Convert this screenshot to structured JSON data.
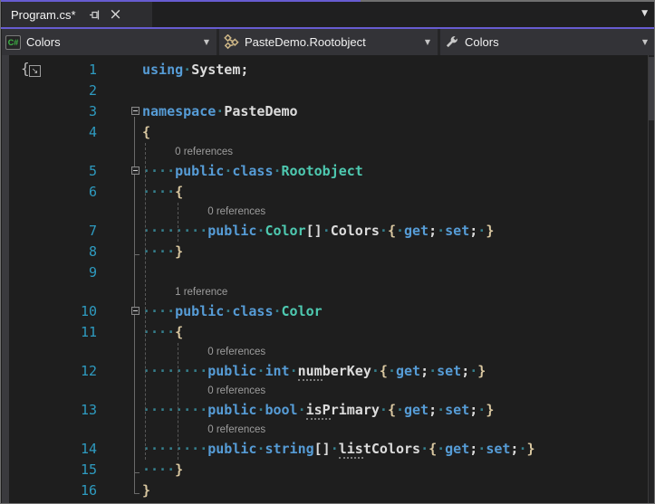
{
  "tab_bar": {
    "active_tab": {
      "title": "Program.cs*"
    },
    "pin_icon": "pin",
    "close_icon": "close",
    "tab_list_icon": "▼"
  },
  "nav_bar": {
    "project": {
      "label": "Colors",
      "icon": "csharp-project-icon",
      "badge_text": "C#"
    },
    "type": {
      "label": "PasteDemo.Rootobject",
      "icon": "class-icon"
    },
    "member": {
      "label": "Colors",
      "icon": "wrench-property-icon"
    },
    "chevron": "▼"
  },
  "editor": {
    "rows": [
      {
        "n": "1",
        "kind": "code",
        "tokens": [
          {
            "t": "using",
            "c": "kw"
          },
          {
            "t": "·",
            "c": "ws"
          },
          {
            "t": "System;",
            "c": "txt"
          }
        ]
      },
      {
        "n": "2",
        "kind": "code",
        "tokens": []
      },
      {
        "n": "3",
        "kind": "code",
        "fold": true,
        "tokens": [
          {
            "t": "namespace",
            "c": "kw"
          },
          {
            "t": "·",
            "c": "ws"
          },
          {
            "t": "PasteDemo",
            "c": "txt"
          }
        ]
      },
      {
        "n": "4",
        "kind": "code",
        "tokens": [
          {
            "t": "{",
            "c": "brace"
          }
        ]
      },
      {
        "kind": "lens",
        "ind": 4,
        "tokens": [
          {
            "t": "0 references",
            "c": "lens"
          }
        ]
      },
      {
        "n": "5",
        "kind": "code",
        "fold": true,
        "tokens": [
          {
            "t": "····",
            "c": "ws"
          },
          {
            "t": "public",
            "c": "kw"
          },
          {
            "t": "·",
            "c": "ws"
          },
          {
            "t": "class",
            "c": "kw"
          },
          {
            "t": "·",
            "c": "ws"
          },
          {
            "t": "Rootobject",
            "c": "cls"
          }
        ]
      },
      {
        "n": "6",
        "kind": "code",
        "tokens": [
          {
            "t": "····",
            "c": "ws"
          },
          {
            "t": "{",
            "c": "brace"
          }
        ]
      },
      {
        "kind": "lens",
        "ind": 8,
        "tokens": [
          {
            "t": "0 references",
            "c": "lens"
          }
        ]
      },
      {
        "n": "7",
        "kind": "code",
        "tokens": [
          {
            "t": "········",
            "c": "ws"
          },
          {
            "t": "public",
            "c": "kw"
          },
          {
            "t": "·",
            "c": "ws"
          },
          {
            "t": "Color",
            "c": "cls"
          },
          {
            "t": "[]",
            "c": "txt"
          },
          {
            "t": "·",
            "c": "ws"
          },
          {
            "t": "Colors",
            "c": "txt"
          },
          {
            "t": "·",
            "c": "ws"
          },
          {
            "t": "{",
            "c": "brace"
          },
          {
            "t": "·",
            "c": "ws"
          },
          {
            "t": "get",
            "c": "kw"
          },
          {
            "t": ";",
            "c": "txt"
          },
          {
            "t": "·",
            "c": "ws"
          },
          {
            "t": "set",
            "c": "kw"
          },
          {
            "t": ";",
            "c": "txt"
          },
          {
            "t": "·",
            "c": "ws"
          },
          {
            "t": "}",
            "c": "brace"
          }
        ]
      },
      {
        "n": "8",
        "kind": "code",
        "tokens": [
          {
            "t": "····",
            "c": "ws"
          },
          {
            "t": "}",
            "c": "brace"
          }
        ]
      },
      {
        "n": "9",
        "kind": "code",
        "tokens": []
      },
      {
        "kind": "lens",
        "ind": 4,
        "tokens": [
          {
            "t": "1 reference",
            "c": "lens"
          }
        ]
      },
      {
        "n": "10",
        "kind": "code",
        "fold": true,
        "tokens": [
          {
            "t": "····",
            "c": "ws"
          },
          {
            "t": "public",
            "c": "kw"
          },
          {
            "t": "·",
            "c": "ws"
          },
          {
            "t": "class",
            "c": "kw"
          },
          {
            "t": "·",
            "c": "ws"
          },
          {
            "t": "Color",
            "c": "cls"
          }
        ]
      },
      {
        "n": "11",
        "kind": "code",
        "tokens": [
          {
            "t": "····",
            "c": "ws"
          },
          {
            "t": "{",
            "c": "brace"
          }
        ]
      },
      {
        "kind": "lens",
        "ind": 8,
        "tokens": [
          {
            "t": "0 references",
            "c": "lens"
          }
        ]
      },
      {
        "n": "12",
        "kind": "code",
        "tokens": [
          {
            "t": "········",
            "c": "ws"
          },
          {
            "t": "public",
            "c": "kw"
          },
          {
            "t": "·",
            "c": "ws"
          },
          {
            "t": "int",
            "c": "kw"
          },
          {
            "t": "·",
            "c": "ws"
          },
          {
            "t": "num",
            "c": "warn"
          },
          {
            "t": "berKey",
            "c": "txt"
          },
          {
            "t": "·",
            "c": "ws"
          },
          {
            "t": "{",
            "c": "brace"
          },
          {
            "t": "·",
            "c": "ws"
          },
          {
            "t": "get",
            "c": "kw"
          },
          {
            "t": ";",
            "c": "txt"
          },
          {
            "t": "·",
            "c": "ws"
          },
          {
            "t": "set",
            "c": "kw"
          },
          {
            "t": ";",
            "c": "txt"
          },
          {
            "t": "·",
            "c": "ws"
          },
          {
            "t": "}",
            "c": "brace"
          }
        ]
      },
      {
        "kind": "lens",
        "ind": 8,
        "tokens": [
          {
            "t": "0 references",
            "c": "lens"
          }
        ]
      },
      {
        "n": "13",
        "kind": "code",
        "tokens": [
          {
            "t": "········",
            "c": "ws"
          },
          {
            "t": "public",
            "c": "kw"
          },
          {
            "t": "·",
            "c": "ws"
          },
          {
            "t": "bool",
            "c": "kw"
          },
          {
            "t": "·",
            "c": "ws"
          },
          {
            "t": "isP",
            "c": "warn"
          },
          {
            "t": "rimary",
            "c": "txt"
          },
          {
            "t": "·",
            "c": "ws"
          },
          {
            "t": "{",
            "c": "brace"
          },
          {
            "t": "·",
            "c": "ws"
          },
          {
            "t": "get",
            "c": "kw"
          },
          {
            "t": ";",
            "c": "txt"
          },
          {
            "t": "·",
            "c": "ws"
          },
          {
            "t": "set",
            "c": "kw"
          },
          {
            "t": ";",
            "c": "txt"
          },
          {
            "t": "·",
            "c": "ws"
          },
          {
            "t": "}",
            "c": "brace"
          }
        ]
      },
      {
        "kind": "lens",
        "ind": 8,
        "tokens": [
          {
            "t": "0 references",
            "c": "lens"
          }
        ]
      },
      {
        "n": "14",
        "kind": "code",
        "tokens": [
          {
            "t": "········",
            "c": "ws"
          },
          {
            "t": "public",
            "c": "kw"
          },
          {
            "t": "·",
            "c": "ws"
          },
          {
            "t": "string",
            "c": "kw"
          },
          {
            "t": "[]",
            "c": "txt"
          },
          {
            "t": "·",
            "c": "ws"
          },
          {
            "t": "lis",
            "c": "warn"
          },
          {
            "t": "tColors",
            "c": "txt"
          },
          {
            "t": "·",
            "c": "ws"
          },
          {
            "t": "{",
            "c": "brace"
          },
          {
            "t": "·",
            "c": "ws"
          },
          {
            "t": "get",
            "c": "kw"
          },
          {
            "t": ";",
            "c": "txt"
          },
          {
            "t": "·",
            "c": "ws"
          },
          {
            "t": "set",
            "c": "kw"
          },
          {
            "t": ";",
            "c": "txt"
          },
          {
            "t": "·",
            "c": "ws"
          },
          {
            "t": "}",
            "c": "brace"
          }
        ]
      },
      {
        "n": "15",
        "kind": "code",
        "tokens": [
          {
            "t": "····",
            "c": "ws"
          },
          {
            "t": "}",
            "c": "brace"
          }
        ]
      },
      {
        "n": "16",
        "kind": "code",
        "tokens": [
          {
            "t": "}",
            "c": "brace"
          }
        ]
      }
    ]
  },
  "colors": {
    "accent_purple": "#675CD1",
    "tabstrip_bg": "#1F1F20",
    "tab_bg": "#2D2D30",
    "navbar_bg": "#333337",
    "editor_bg": "#1E1E1E",
    "gutter_strip": "#3A3A3E",
    "line_number": "#2E9BC0",
    "keyword": "#569CD6",
    "class_name": "#4EC9B0",
    "plain_text": "#DCDCDC",
    "brace": "#D9C7A0",
    "whitespace_dot": "#35808E",
    "codelens": "#9D9D9D",
    "guide": "#585858",
    "outline": "#6A6A6A",
    "border_gray": "#6F6F6F"
  }
}
